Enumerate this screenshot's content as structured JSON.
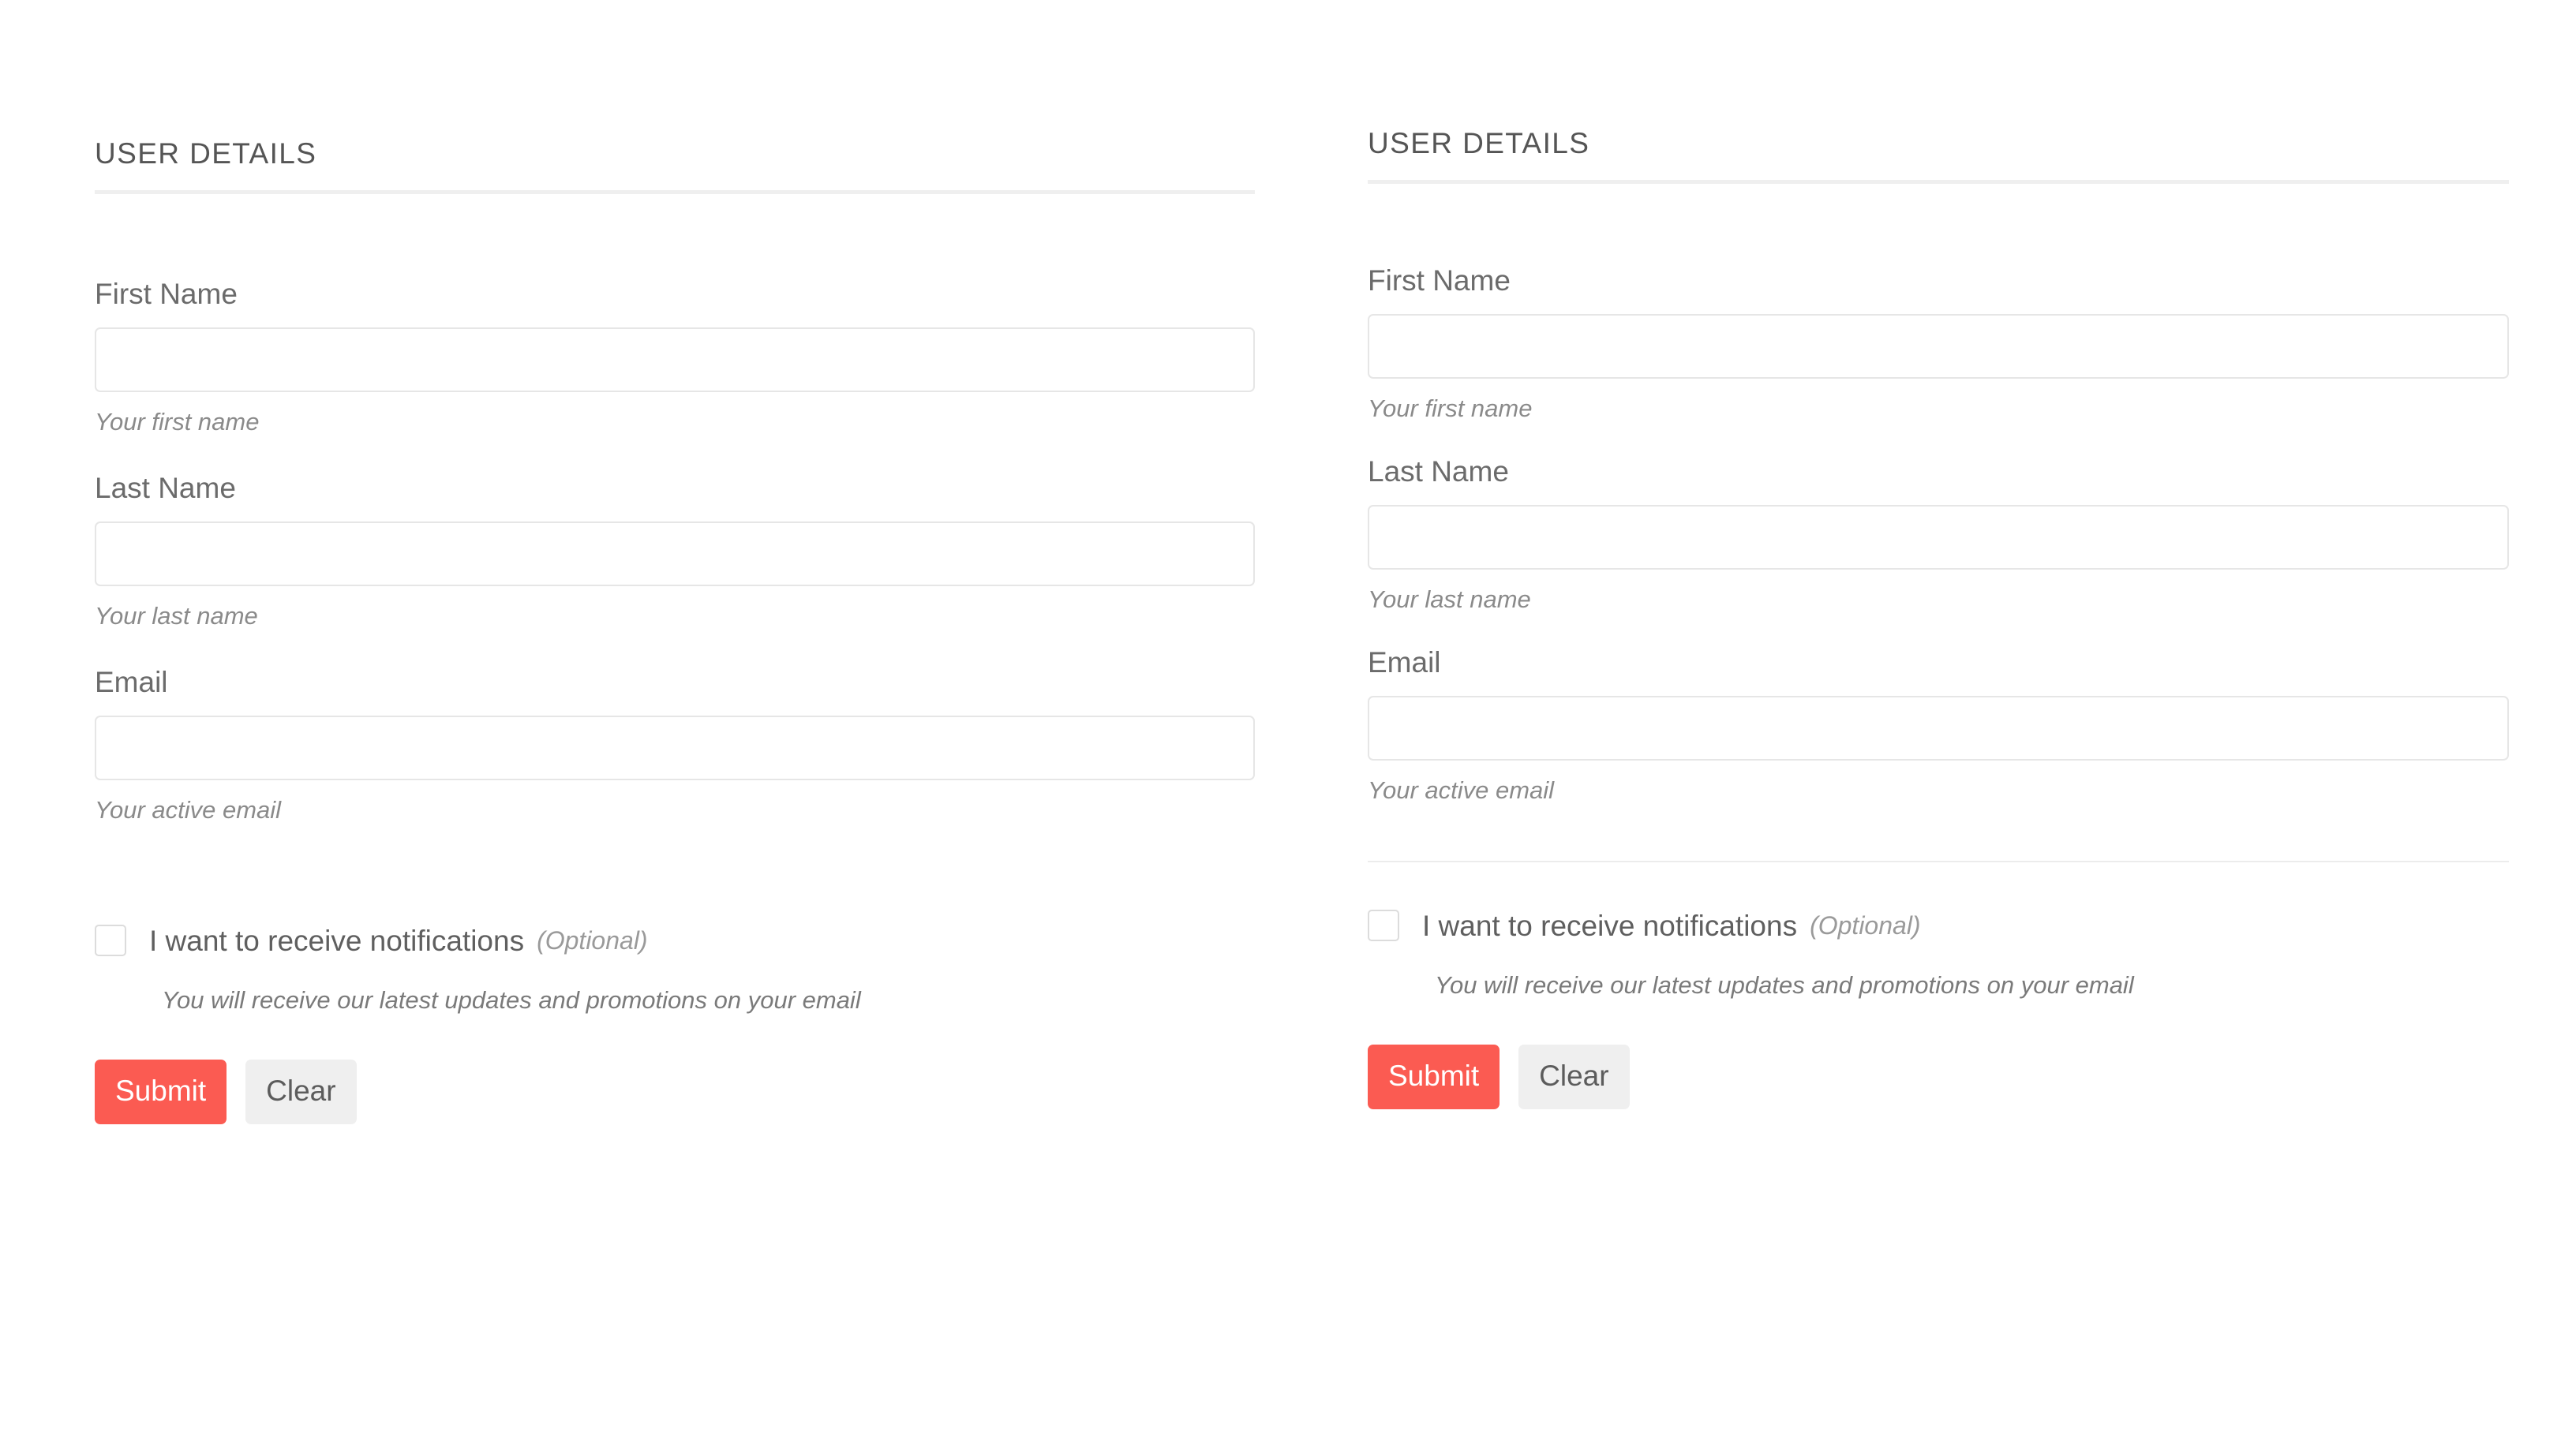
{
  "theme": {
    "background": "#ffffff",
    "accent": "#fb5b52",
    "label_color": "#6b6b6b",
    "help_color": "#8a8a8a",
    "border_color": "#e6e6e6",
    "rule_color": "#efefef",
    "clear_button_bg": "#efefef"
  },
  "forms": [
    {
      "heading": "USER DETAILS",
      "fields": [
        {
          "label": "First Name",
          "value": "",
          "placeholder": "",
          "help": "Your first name"
        },
        {
          "label": "Last Name",
          "value": "",
          "placeholder": "",
          "help": "Your last name"
        },
        {
          "label": "Email",
          "value": "",
          "placeholder": "",
          "help": "Your active email"
        }
      ],
      "checkbox": {
        "label": "I want to receive notifications",
        "optional_tag": "(Optional)",
        "checked": false,
        "help": "You will receive our latest updates and promotions on your email"
      },
      "buttons": {
        "submit": "Submit",
        "clear": "Clear"
      },
      "has_divider_above_checkbox": false
    },
    {
      "heading": "USER DETAILS",
      "fields": [
        {
          "label": "First Name",
          "value": "",
          "placeholder": "",
          "help": "Your first name"
        },
        {
          "label": "Last Name",
          "value": "",
          "placeholder": "",
          "help": "Your last name"
        },
        {
          "label": "Email",
          "value": "",
          "placeholder": "",
          "help": "Your active email"
        }
      ],
      "checkbox": {
        "label": "I want to receive notifications",
        "optional_tag": "(Optional)",
        "checked": false,
        "help": "You will receive our latest updates and promotions on your email"
      },
      "buttons": {
        "submit": "Submit",
        "clear": "Clear"
      },
      "has_divider_above_checkbox": true
    }
  ]
}
